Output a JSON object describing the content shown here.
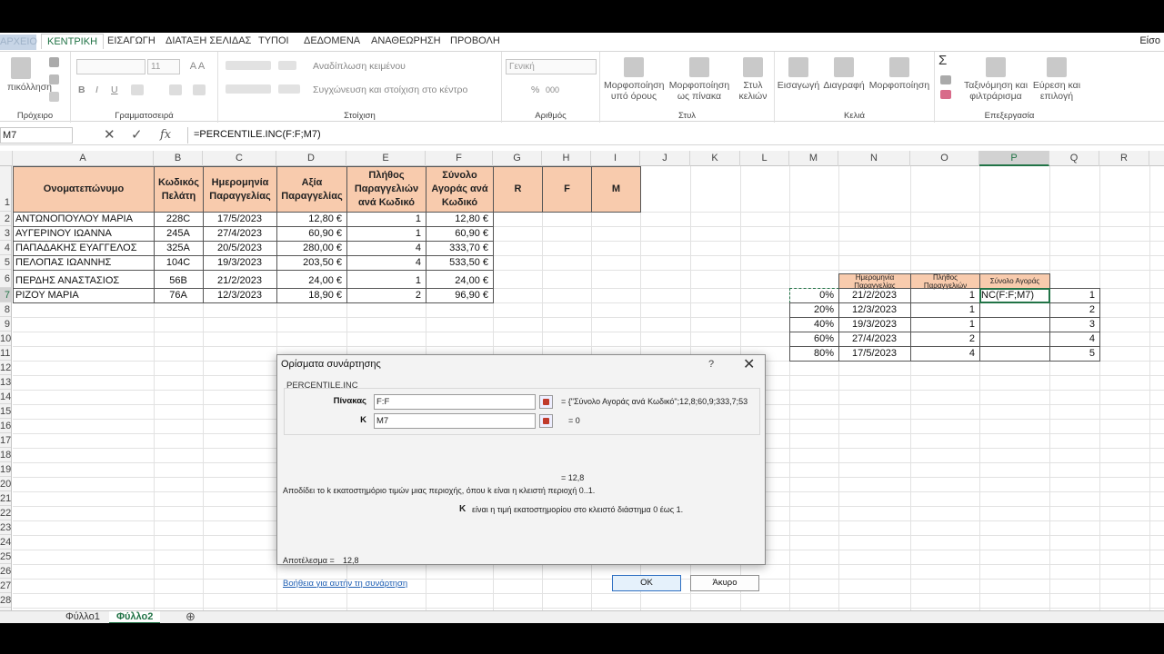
{
  "tabs": {
    "file": "ΑΡΧΕΙΟ",
    "home": "ΚΕΝΤΡΙΚΗ",
    "insert": "ΕΙΣΑΓΩΓΗ",
    "layout": "ΔΙΑΤΑΞΗ ΣΕΛΙΔΑΣ",
    "formulas": "ΤΥΠΟΙ",
    "data": "ΔΕΔΟΜΕΝΑ",
    "review": "ΑΝΑΘΕΩΡΗΣΗ",
    "view": "ΠΡΟΒΟΛΗ",
    "signin": "Είσο"
  },
  "ribbon": {
    "clipboard": {
      "paste": "πικόλληση",
      "label": "Πρόχειρο"
    },
    "font": {
      "size": "11",
      "label": "Γραμματοσειρά",
      "bold": "B",
      "italic": "I",
      "underline": "U"
    },
    "alignment": {
      "wrap": "Αναδίπλωση κειμένου",
      "merge": "Συγχώνευση και στοίχιση στο κέντρο",
      "label": "Στοίχιση"
    },
    "number": {
      "format": "Γενική",
      "label": "Αριθμός",
      "percent": "%",
      "thousands": "000"
    },
    "styles": {
      "cond1": "Μορφοποίηση",
      "cond2": "υπό όρους",
      "table1": "Μορφοποίηση",
      "table2": "ως πίνακα",
      "cell1": "Στυλ",
      "cell2": "κελιών",
      "label": "Στυλ"
    },
    "cells": {
      "insert": "Εισαγωγή",
      "delete": "Διαγραφή",
      "format": "Μορφοποίηση",
      "label": "Κελιά"
    },
    "editing": {
      "sort1": "Ταξινόμηση και",
      "sort2": "φιλτράρισμα",
      "find1": "Εύρεση και",
      "find2": "επιλογή",
      "label": "Επεξεργασία"
    }
  },
  "formula_bar": {
    "namebox": "M7",
    "fx": "fx",
    "formula": "=PERCENTILE.INC(F:F;M7)"
  },
  "columns": [
    "A",
    "B",
    "C",
    "D",
    "E",
    "F",
    "G",
    "H",
    "I",
    "J",
    "K",
    "L",
    "M",
    "N",
    "O",
    "P",
    "Q",
    "R",
    "S"
  ],
  "rows": [
    "1",
    "2",
    "3",
    "4",
    "5",
    "6",
    "7",
    "8",
    "9",
    "10",
    "11",
    "12",
    "13",
    "14",
    "15",
    "16",
    "17",
    "18",
    "19",
    "20",
    "21",
    "22",
    "23",
    "24",
    "25",
    "26",
    "27",
    "28"
  ],
  "table": {
    "headers": [
      "Ονοματεπώνυμο",
      "Κωδικός Πελάτη",
      "Ημερομηνία Παραγγελίας",
      "Αξία Παραγγελίας",
      "Πλήθος Παραγγελιών ανά Κωδικό",
      "Σύνολο Αγοράς ανά Κωδικό",
      "R",
      "F",
      "M"
    ],
    "rows": [
      [
        "ΑΝΤΩΝΟΠΟΥΛΟΥ ΜΑΡΙΑ",
        "228C",
        "17/5/2023",
        "12,80 €",
        "1",
        "12,80 €"
      ],
      [
        "ΑΥΓΕΡΙΝΟΥ ΙΩΑΝΝΑ",
        "245A",
        "27/4/2023",
        "60,90 €",
        "1",
        "60,90 €"
      ],
      [
        "ΠΑΠΑΔΑΚΗΣ ΕΥΑΓΓΕΛΟΣ",
        "325A",
        "20/5/2023",
        "280,00 €",
        "4",
        "333,70 €"
      ],
      [
        "ΠΕΛΟΠΑΣ ΙΩΑΝΝΗΣ",
        "104C",
        "19/3/2023",
        "203,50 €",
        "4",
        "533,50 €"
      ],
      [
        "ΠΕΡΔΗΣ ΑΝΑΣΤΑΣΙΟΣ",
        "56B",
        "21/2/2023",
        "24,00 €",
        "1",
        "24,00 €"
      ],
      [
        "ΡΙΖΟΥ ΜΑΡΙΑ",
        "76A",
        "12/3/2023",
        "18,90 €",
        "2",
        "96,90 €"
      ]
    ]
  },
  "side_table": {
    "headers": [
      "Ημερομηνία Παραγγελίας",
      "Πλήθος Παραγγελιών",
      "Σύνολο Αγοράς"
    ],
    "rows": [
      [
        "0%",
        "21/2/2023",
        "1",
        "NC(F:F;M7)",
        "1"
      ],
      [
        "20%",
        "12/3/2023",
        "1",
        "",
        "2"
      ],
      [
        "40%",
        "19/3/2023",
        "1",
        "",
        "3"
      ],
      [
        "60%",
        "27/4/2023",
        "2",
        "",
        "4"
      ],
      [
        "80%",
        "17/5/2023",
        "4",
        "",
        "5"
      ]
    ]
  },
  "sheets": [
    "Φύλλο1",
    "Φύλλο2"
  ],
  "dialog": {
    "title": "Ορίσματα συνάρτησης",
    "help_q": "?",
    "close": "✕",
    "function": "PERCENTILE.INC",
    "arg1_label": "Πίνακας",
    "arg1_value": "F:F",
    "arg1_result": "= {\"Σύνολο Αγοράς ανά Κωδικό\";12,8;60,9;333,7;53",
    "arg2_label": "K",
    "arg2_value": "M7",
    "arg2_result": "= 0",
    "formula_result_eq": "= 12,8",
    "description": "Αποδίδει το k εκατοστημόριο τιμών μιας περιοχής, όπου k είναι η κλειστή περιοχή 0..1.",
    "k_label": "K",
    "k_desc": "είναι η τιμή εκατοστημορίου στο κλειστό διάστημα 0 έως 1.",
    "result_label": "Αποτέλεσμα =",
    "result_value": "12,8",
    "help_link": "Βοήθεια για αυτήν τη συνάρτηση",
    "ok": "OK",
    "cancel": "Άκυρο"
  }
}
